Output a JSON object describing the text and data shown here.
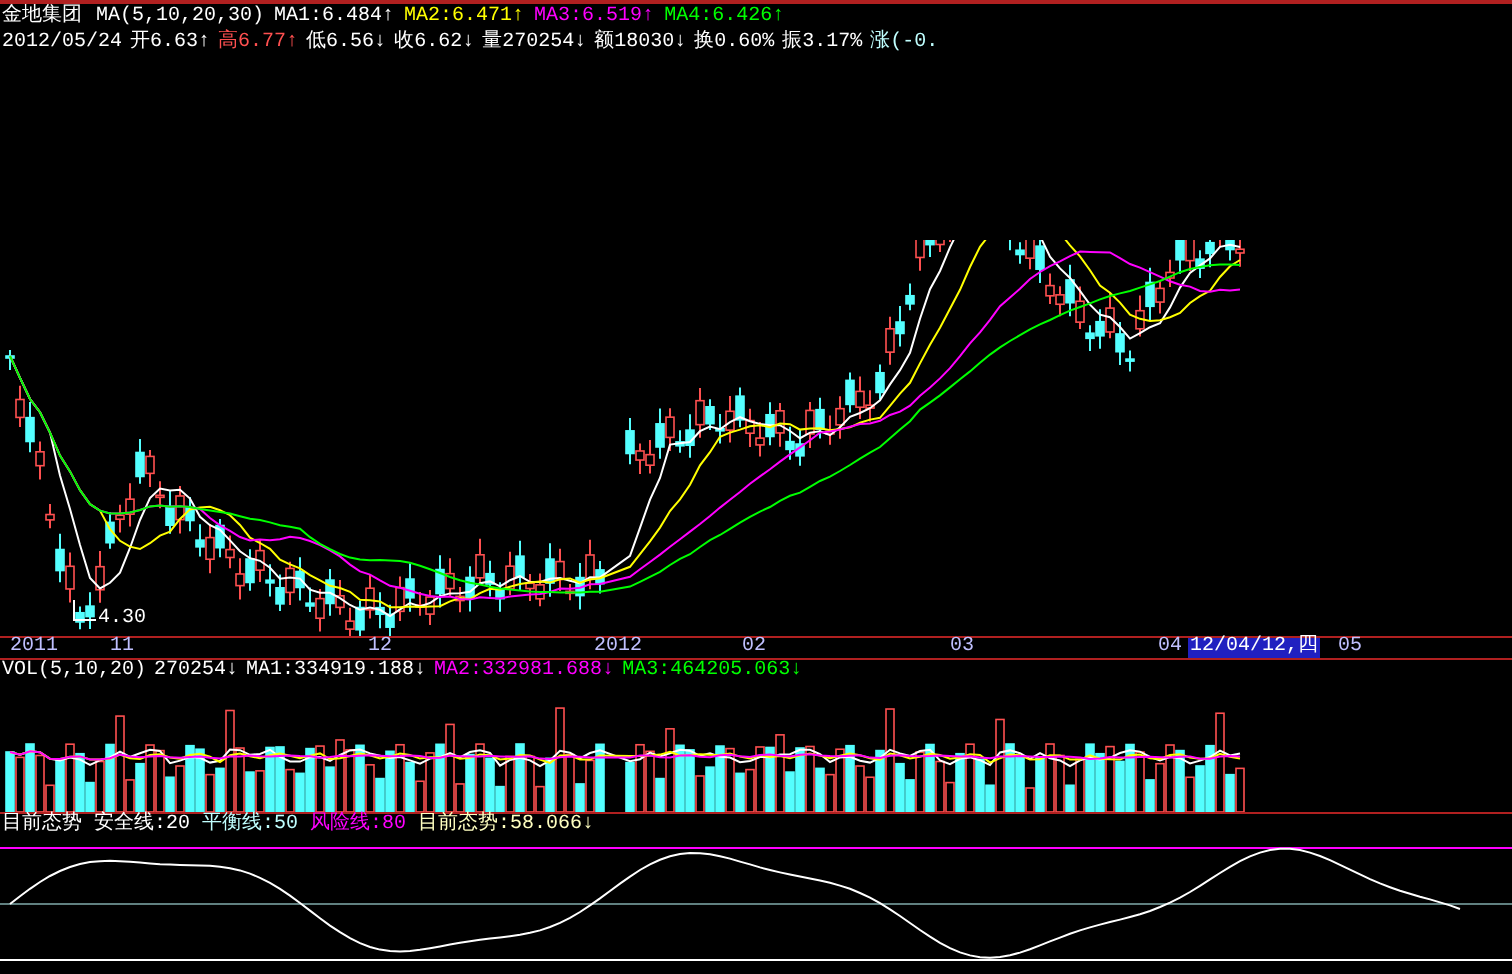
{
  "quote_header": {
    "name": "金地集团",
    "ma_label": "MA(5,10,20,30)",
    "ma_values": [
      {
        "text": "MA1:6.484↑",
        "color": "#ffffff"
      },
      {
        "text": "MA2:6.471↑",
        "color": "#ffff00"
      },
      {
        "text": "MA3:6.519↑",
        "color": "#ff00ff"
      },
      {
        "text": "MA4:6.426↑",
        "color": "#00ff00"
      }
    ]
  },
  "day_line": [
    {
      "text": "2012/05/24",
      "color": "#ffffff"
    },
    {
      "text": "开6.63↑",
      "color": "#ffffff"
    },
    {
      "text": "高6.77↑",
      "color": "#ff5050"
    },
    {
      "text": "低6.56↓",
      "color": "#ffffff"
    },
    {
      "text": "收6.62↓",
      "color": "#ffffff"
    },
    {
      "text": "量270254↓",
      "color": "#ffffff"
    },
    {
      "text": "额18030↓",
      "color": "#ffffff"
    },
    {
      "text": "换0.60%",
      "color": "#ffffff"
    },
    {
      "text": "振3.17%",
      "color": "#ffffff"
    },
    {
      "text": "涨(-0.",
      "color": "#c0ffff"
    }
  ],
  "price_note": "4.30",
  "time_axis": [
    {
      "text": "2011",
      "selected": false
    },
    {
      "text": "11",
      "selected": false
    },
    {
      "text": "12",
      "selected": false
    },
    {
      "text": "2012",
      "selected": false
    },
    {
      "text": "02",
      "selected": false
    },
    {
      "text": "03",
      "selected": false
    },
    {
      "text": "04",
      "selected": false
    },
    {
      "text": "12/04/12,四",
      "selected": true
    },
    {
      "text": "05",
      "selected": false
    }
  ],
  "volume_header": [
    {
      "text": "VOL(5,10,20)",
      "color": "#ffffff"
    },
    {
      "text": "270254↓",
      "color": "#ffffff"
    },
    {
      "text": "MA1:334919.188↓",
      "color": "#ffffff"
    },
    {
      "text": "MA2:332981.688↓",
      "color": "#ff00ff"
    },
    {
      "text": "MA3:464205.063↓",
      "color": "#00ff00"
    }
  ],
  "indicator_header": [
    {
      "text": "目前态势",
      "color": "#ffffff"
    },
    {
      "text": "安全线:20",
      "color": "#ffffff"
    },
    {
      "text": "平衡线:50",
      "color": "#c0ffff"
    },
    {
      "text": "风险线:80",
      "color": "#ff00ff"
    },
    {
      "text": "目前态势:58.066↓",
      "color": "#ffffc0"
    }
  ]
}
